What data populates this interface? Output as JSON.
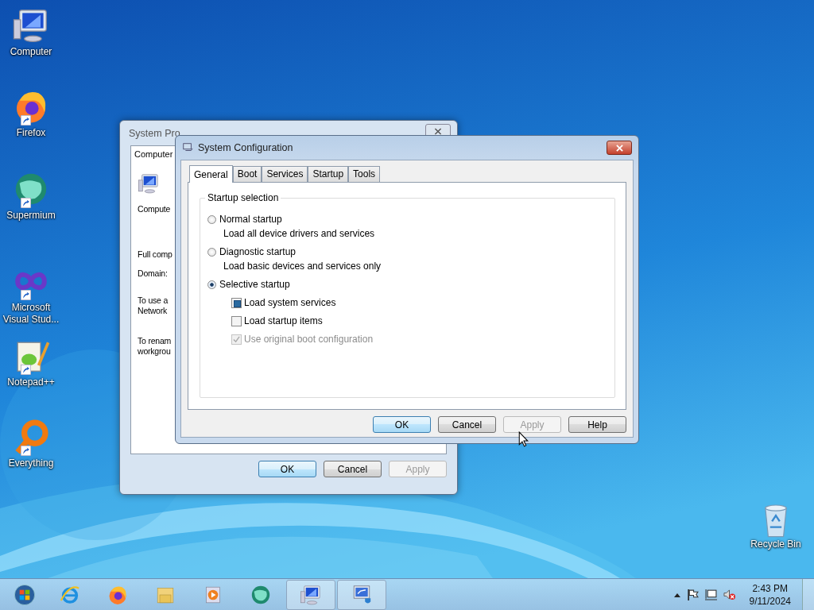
{
  "desktop_icons": [
    {
      "kind": "computer",
      "label": "Computer",
      "shortcut": false
    },
    {
      "kind": "fox",
      "label": "Firefox",
      "shortcut": true
    },
    {
      "kind": "sphere",
      "label": "Supermium",
      "shortcut": true
    },
    {
      "kind": "infinity",
      "label": "Microsoft Visual Stud...",
      "shortcut": true
    },
    {
      "kind": "notepad",
      "label": "Notepad++",
      "shortcut": true
    },
    {
      "kind": "ring",
      "label": "Everything",
      "shortcut": true
    }
  ],
  "recycle_bin": {
    "label": "Recycle Bin"
  },
  "back_window": {
    "title": "System Pro",
    "tab": "Computer",
    "texts": [
      {
        "kind": "line",
        "text": "Compute"
      },
      {
        "kind": "line",
        "text": "Full comp"
      },
      {
        "kind": "line",
        "text": "Domain:"
      },
      {
        "kind": "pair",
        "text": "To use a",
        "text2": "Network"
      },
      {
        "kind": "pair",
        "text": "To renam",
        "text2": "workgrou"
      }
    ],
    "buttons": [
      {
        "label": "OK",
        "default": true,
        "disabled": false
      },
      {
        "label": "Cancel",
        "default": false,
        "disabled": false
      },
      {
        "label": "Apply",
        "default": false,
        "disabled": true
      }
    ]
  },
  "front_window": {
    "title": "System Configuration",
    "tabs": [
      {
        "label": "General",
        "selected": true
      },
      {
        "label": "Boot",
        "selected": false
      },
      {
        "label": "Services",
        "selected": false
      },
      {
        "label": "Startup",
        "selected": false
      },
      {
        "label": "Tools",
        "selected": false
      }
    ],
    "group_label": "Startup selection",
    "options": [
      {
        "label": "Normal startup",
        "selected": false,
        "description": "Load all device drivers and services"
      },
      {
        "label": "Diagnostic startup",
        "selected": false,
        "description": "Load basic devices and services only"
      },
      {
        "label": "Selective startup",
        "selected": true
      }
    ],
    "checkboxes": [
      {
        "label": "Load system services",
        "checked": false,
        "mixed": true,
        "disabled": false
      },
      {
        "label": "Load startup items",
        "checked": false,
        "mixed": false,
        "disabled": false
      },
      {
        "label": "Use original boot configuration",
        "checked": true,
        "mixed": false,
        "disabled": true
      }
    ],
    "buttons": [
      {
        "label": "OK",
        "default": true,
        "disabled": false
      },
      {
        "label": "Cancel",
        "default": false,
        "disabled": false
      },
      {
        "label": "Apply",
        "default": false,
        "disabled": true
      },
      {
        "label": "Help",
        "default": false,
        "disabled": false
      }
    ]
  },
  "taskbar": {
    "items": [
      {
        "kind": "start",
        "running": false
      },
      {
        "kind": "globe",
        "running": false
      },
      {
        "kind": "fox",
        "running": false
      },
      {
        "kind": "folder",
        "running": false
      },
      {
        "kind": "media",
        "running": false
      },
      {
        "kind": "sphere",
        "running": false
      },
      {
        "kind": "computer",
        "running": true
      },
      {
        "kind": "settings",
        "running": true
      }
    ],
    "time": "2:43 PM",
    "date": "9/11/2024"
  }
}
